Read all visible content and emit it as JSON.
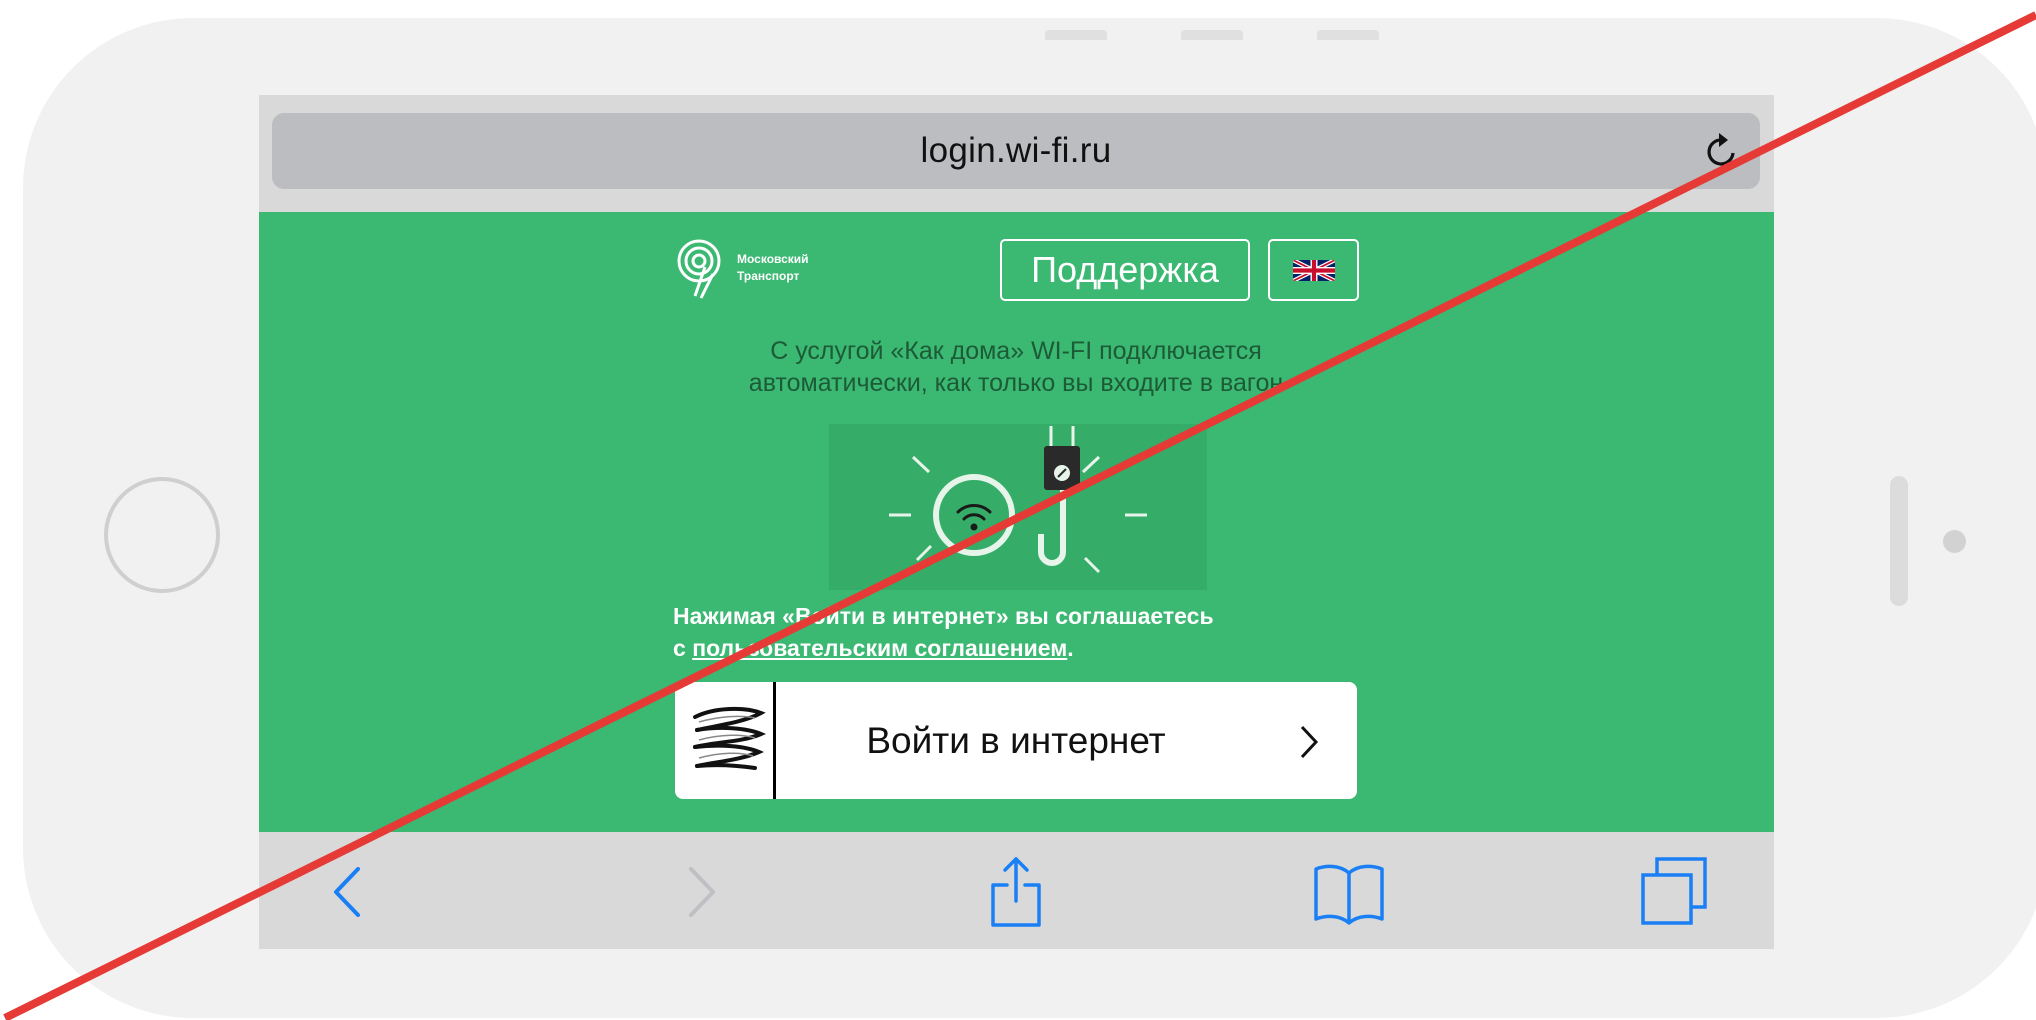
{
  "browser": {
    "url": "login.wi-fi.ru",
    "reload_icon": "reload-icon"
  },
  "header": {
    "logo_line1": "Московский",
    "logo_line2": "Транспорт",
    "support_label": "Поддержка",
    "language_icon": "uk-flag-icon"
  },
  "content": {
    "info_line1": "С услугой «Как дома» WI-FI подключается",
    "info_line2": "автоматически, как только вы входите в вагон",
    "agreement_line1": "Нажимая «Войти в интернет» вы соглашаетесь",
    "agreement_prefix": "с ",
    "agreement_link": "пользовательским соглашением",
    "agreement_suffix": ".",
    "login_label": "Войти в интернет"
  },
  "toolbar": {
    "icons": [
      "back-icon",
      "forward-icon",
      "share-icon",
      "bookmarks-icon",
      "tabs-icon"
    ]
  },
  "colors": {
    "page_green": "#3bb872",
    "toolbar_blue": "#1a7ff5",
    "overlay_red": "#e53a35"
  }
}
